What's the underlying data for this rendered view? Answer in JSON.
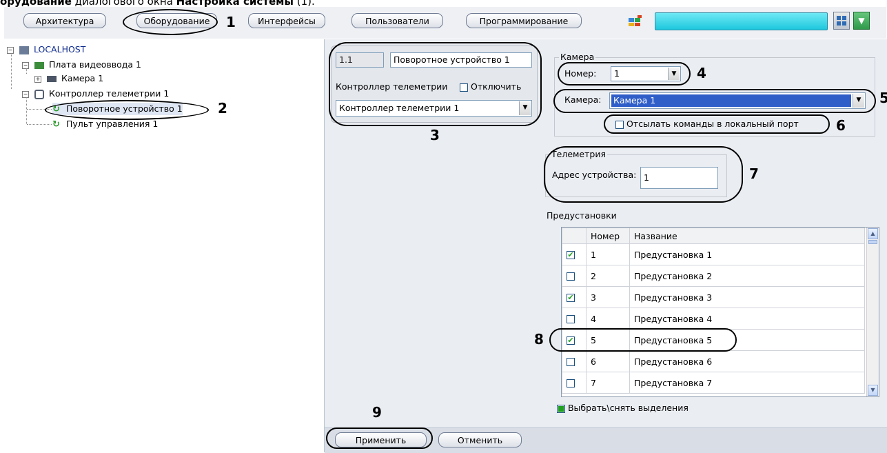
{
  "caption": {
    "prefix": "орудование",
    "middle": " диалогового окна ",
    "bold2": "Настройка системы",
    "suffix": " (1)."
  },
  "toolbar": {
    "tabs": [
      "Архитектура",
      "Оборудование",
      "Интерфейсы",
      "Пользователи",
      "Программирование"
    ]
  },
  "tree": {
    "root": "LOCALHOST",
    "board": "Плата видеоввода 1",
    "camera": "Камера 1",
    "controller": "Контроллер телеметрии 1",
    "ptz": "Поворотное устройство 1",
    "console": "Пульт управления 1"
  },
  "object": {
    "id": "1.1",
    "name": "Поворотное устройство 1",
    "parent_label": "Контроллер телеметрии",
    "disable_label": "Отключить",
    "parent_value": "Контроллер телеметрии 1"
  },
  "camera_group": {
    "title": "Камера",
    "number_label": "Номер:",
    "number_value": "1",
    "camera_label": "Камера:",
    "camera_value": "Камера 1",
    "local_port_label": "Отсылать команды в локальный порт"
  },
  "telemetry_group": {
    "title": "Телеметрия",
    "address_label": "Адрес устройства:",
    "address_value": "1"
  },
  "presets": {
    "title": "Предустановки",
    "col_number": "Номер",
    "col_name": "Название",
    "rows": [
      {
        "n": "1",
        "name": "Предустановка 1",
        "checked": true
      },
      {
        "n": "2",
        "name": "Предустановка 2",
        "checked": false
      },
      {
        "n": "3",
        "name": "Предустановка 3",
        "checked": true
      },
      {
        "n": "4",
        "name": "Предустановка 4",
        "checked": false
      },
      {
        "n": "5",
        "name": "Предустановка 5",
        "checked": true
      },
      {
        "n": "6",
        "name": "Предустановка 6",
        "checked": false
      },
      {
        "n": "7",
        "name": "Предустановка 7",
        "checked": false
      }
    ],
    "select_all_label": "Выбрать\\снять выделения"
  },
  "buttons": {
    "apply": "Применить",
    "cancel": "Отменить"
  },
  "markers": [
    "1",
    "2",
    "3",
    "4",
    "5",
    "6",
    "7",
    "8",
    "9"
  ]
}
